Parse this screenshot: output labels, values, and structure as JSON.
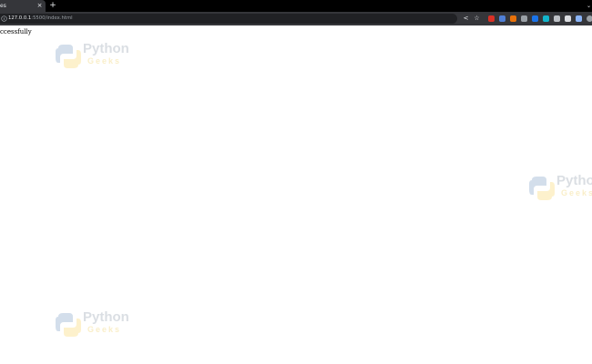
{
  "browser": {
    "tab": {
      "title": "es",
      "close_glyph": "×"
    },
    "new_tab_glyph": "+",
    "tab_menu_glyph": "⌄",
    "address_bar": {
      "host": "127.0.0.1",
      "path": ":5500/index.html"
    },
    "toolbar": {
      "share_glyph": "<",
      "bookmark_glyph": "☆"
    },
    "extensions": [
      {
        "name": "extension-red-icon",
        "color": "#d93025"
      },
      {
        "name": "extension-shield-icon",
        "color": "#4f7fd6"
      },
      {
        "name": "extension-fox-icon",
        "color": "#e8710a"
      },
      {
        "name": "extension-grey-icon",
        "color": "#9aa0a6"
      },
      {
        "name": "extension-blue-icon",
        "color": "#1a73e8"
      },
      {
        "name": "extension-teal-icon",
        "color": "#12b5cb"
      },
      {
        "name": "extension-pin-icon",
        "color": "#bdc1c6"
      },
      {
        "name": "extension-cloud-icon",
        "color": "#dadce0"
      },
      {
        "name": "extension-puzzle-icon",
        "color": "#8ab4f8"
      },
      {
        "name": "profile-avatar-icon",
        "color": "#9aa0a6"
      }
    ]
  },
  "page": {
    "message": "ccessfully"
  },
  "watermark": {
    "line1": "Python",
    "line2": "Geeks",
    "blue": "#3b6fa8",
    "yellow": "#f7c21d"
  }
}
